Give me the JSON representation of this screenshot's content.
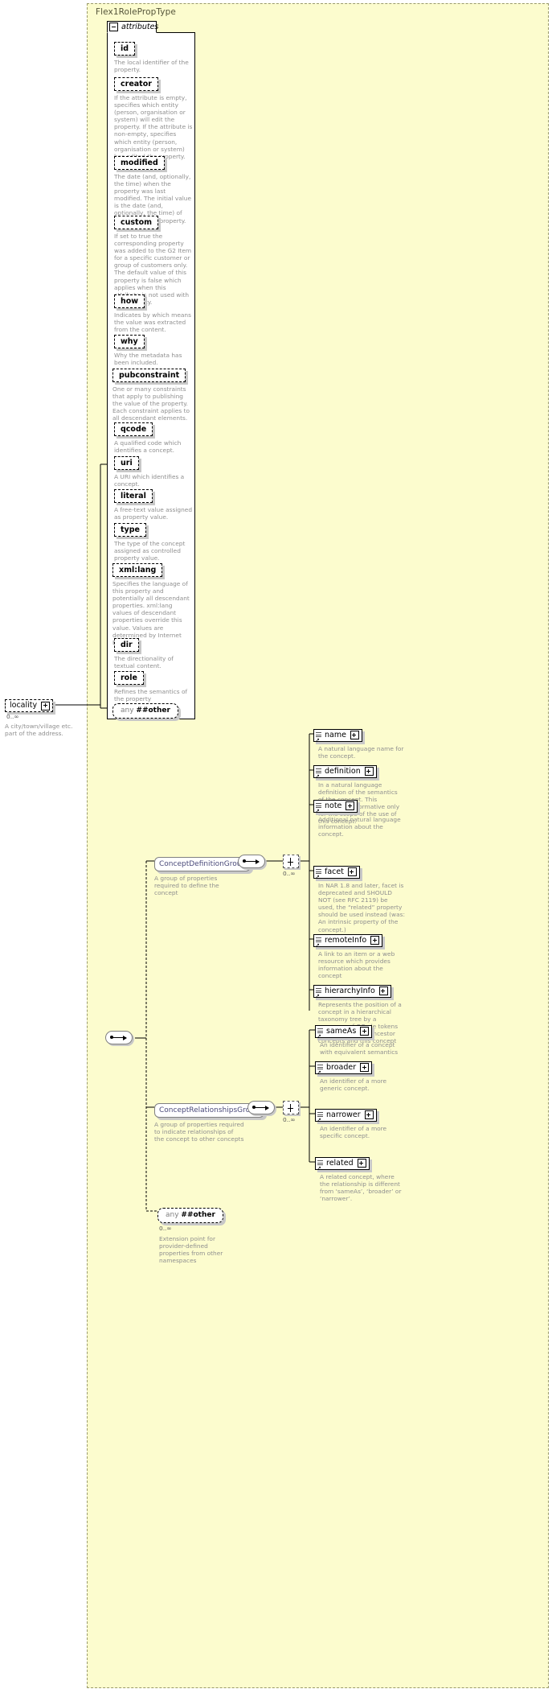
{
  "diagram": {
    "type_name": "Flex1RolePropType",
    "attributes_tab": "attributes",
    "attributes": [
      {
        "name": "id",
        "desc": "The local identifier of the property."
      },
      {
        "name": "creator",
        "desc": "If the attribute is empty, specifies which entity (person, organisation or system) will edit the property. If the attribute is non-empty, specifies which entity (person, organisation or system) has edited the property."
      },
      {
        "name": "modified",
        "desc": "The date (and, optionally, the time) when the property was last modified. The initial value is the date (and, optionally, the time) of creation of the property."
      },
      {
        "name": "custom",
        "desc": "If set to true the corresponding property was added to the G2 Item for a specific customer or group of customers only. The default value of this property is false which applies when this attribute is not used with the property."
      },
      {
        "name": "how",
        "desc": "Indicates by which means the value was extracted from the content."
      },
      {
        "name": "why",
        "desc": "Why the metadata has been included."
      },
      {
        "name": "pubconstraint",
        "desc": "One or many constraints that apply to publishing the value of the property. Each constraint applies to all descendant elements."
      },
      {
        "name": "qcode",
        "desc": "A qualified code which identifies a concept."
      },
      {
        "name": "uri",
        "desc": "A URI which identifies a concept."
      },
      {
        "name": "literal",
        "desc": "A free-text value assigned as property value."
      },
      {
        "name": "type",
        "desc": "The type of the concept assigned as controlled property value."
      },
      {
        "name": "xml:lang",
        "desc": "Specifies the language of this property and potentially all descendant properties. xml:lang values of descendant properties override this value. Values are determined by Internet BCP 47."
      },
      {
        "name": "dir",
        "desc": "The directionality of textual content."
      },
      {
        "name": "role",
        "desc": "Refines the semantics of the property"
      }
    ],
    "attributes_any": {
      "word1": "any",
      "word2": "##other"
    },
    "locality": {
      "label": "locality",
      "cardinality": "0..∞",
      "desc": "A city/town/village etc. part of the address."
    },
    "groups": [
      {
        "label": "ConceptDefinitionGroup",
        "desc": "A group of properties required to define the concept",
        "cardinality": "0..∞",
        "children": [
          {
            "label": "name",
            "desc": "A natural language name for the concept."
          },
          {
            "label": "definition",
            "desc": "In a natural language definition of the semantics of the concept. This definition is normative only for the scope of the use of this concept."
          },
          {
            "label": "note",
            "desc": "Additional natural language information about the concept."
          },
          {
            "label": "facet",
            "desc": "In NAR 1.8 and later, facet is deprecated and SHOULD NOT (see RFC 2119) be used, the “related” property should be used instead (was: An intrinsic property of the concept.)"
          },
          {
            "label": "remoteInfo",
            "desc": "A link to an item or a web resource which provides information about the concept"
          },
          {
            "label": "hierarchyInfo",
            "desc": "Represents the position of a concept in a hierarchical taxonomy tree by a sequence of QCode tokens representing the ancestor concepts and this concept"
          }
        ]
      },
      {
        "label": "ConceptRelationshipsGroup",
        "desc": "A group of properties required to indicate relationships of the concept to other concepts",
        "cardinality": "0..∞",
        "children": [
          {
            "label": "sameAs",
            "desc": "An identifier of a concept with equivalent semantics"
          },
          {
            "label": "broader",
            "desc": "An identifier of a more generic concept."
          },
          {
            "label": "narrower",
            "desc": "An identifier of a more specific concept."
          },
          {
            "label": "related",
            "desc": "A related concept, where the relationship is different from ‘sameAs’, ‘broader’ or ‘narrower’."
          }
        ]
      }
    ],
    "bottom_any": {
      "word1": "any",
      "word2": "##other",
      "cardinality": "0..∞",
      "desc": "Extension point for provider-defined properties from other namespaces"
    },
    "colors": {
      "background": "#fcfcce",
      "panel": "#ffffff",
      "text": "#000000",
      "desc_text": "#8f8f8f",
      "group_text": "#4a4a7a",
      "shadow": "#c8c8c8"
    }
  }
}
